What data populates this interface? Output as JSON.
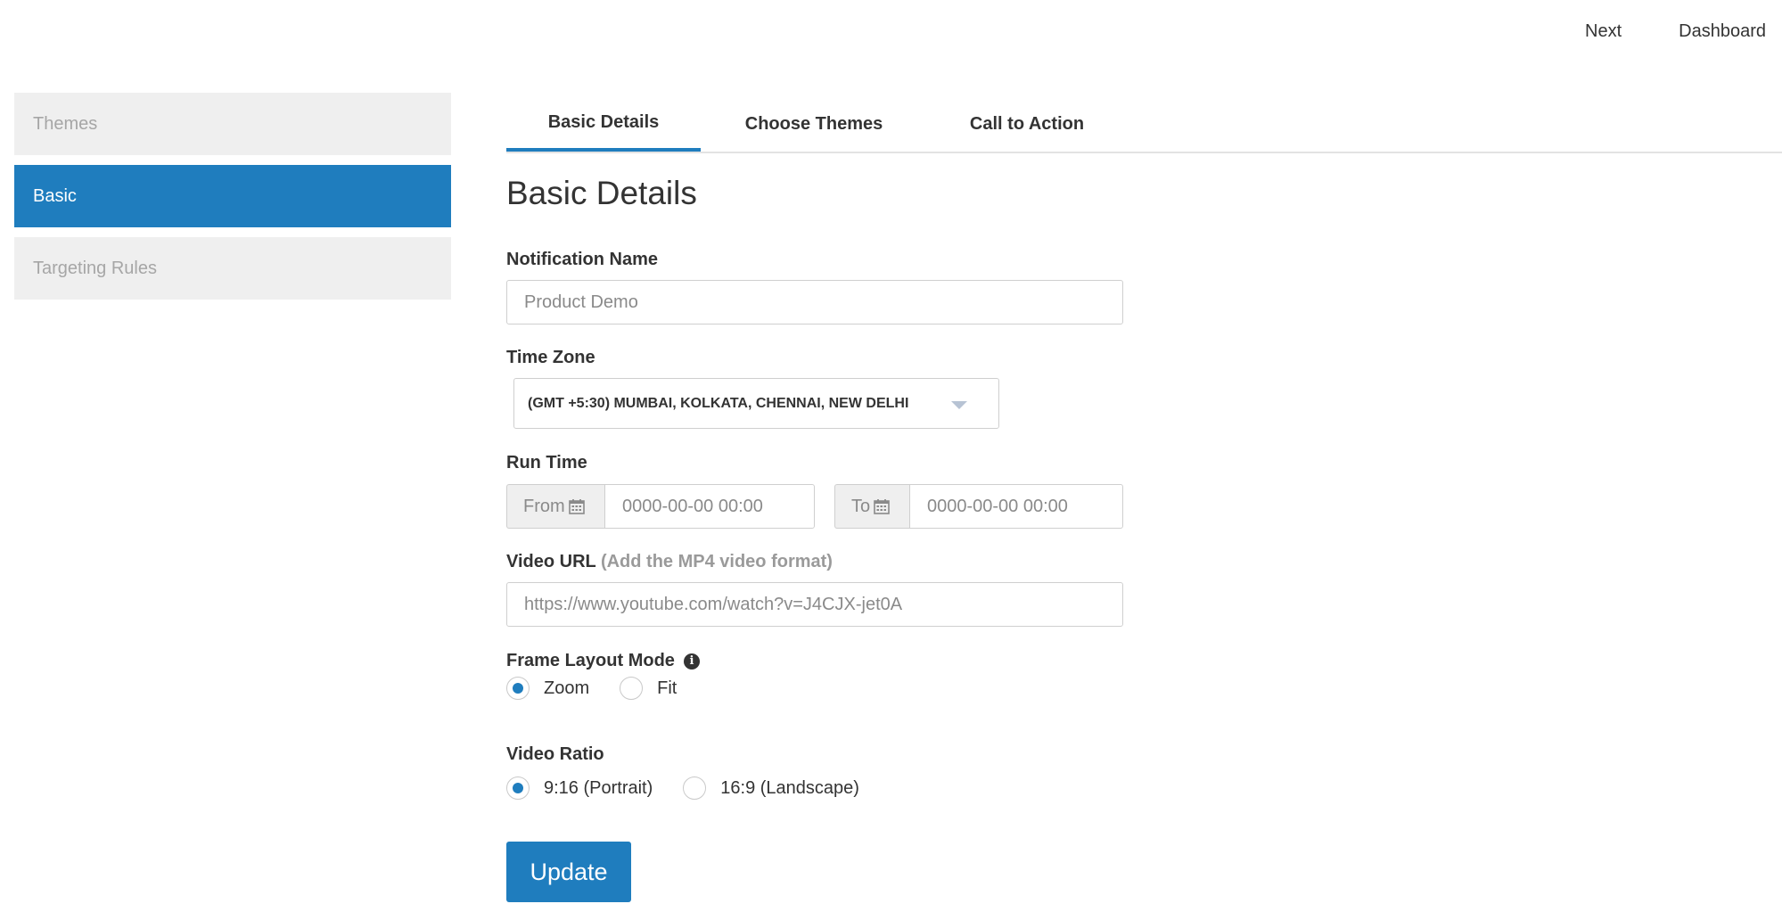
{
  "topnav": {
    "next": "Next",
    "dashboard": "Dashboard"
  },
  "sidebar": {
    "items": [
      {
        "label": "Themes",
        "active": false
      },
      {
        "label": "Basic",
        "active": true
      },
      {
        "label": "Targeting Rules",
        "active": false
      }
    ]
  },
  "tabs": [
    {
      "label": "Basic Details",
      "active": true
    },
    {
      "label": "Choose Themes",
      "active": false
    },
    {
      "label": "Call to Action",
      "active": false
    }
  ],
  "form": {
    "title": "Basic Details",
    "notification_name": {
      "label": "Notification Name",
      "placeholder": "Product Demo"
    },
    "time_zone": {
      "label": "Time Zone",
      "selected": "(GMT +5:30) MUMBAI, KOLKATA, CHENNAI, NEW DELHI"
    },
    "run_time": {
      "label": "Run Time",
      "from_label": "From",
      "from_placeholder": "0000-00-00 00:00",
      "to_label": "To",
      "to_placeholder": "0000-00-00 00:00"
    },
    "video_url": {
      "label": "Video URL",
      "hint": "(Add the MP4 video format)",
      "placeholder": "https://www.youtube.com/watch?v=J4CJX-jet0A"
    },
    "frame_layout": {
      "label": "Frame Layout Mode",
      "options": [
        {
          "label": "Zoom",
          "selected": true
        },
        {
          "label": "Fit",
          "selected": false
        }
      ]
    },
    "video_ratio": {
      "label": "Video Ratio",
      "options": [
        {
          "label": "9:16 (Portrait)",
          "selected": true
        },
        {
          "label": "16:9 (Landscape)",
          "selected": false
        }
      ]
    },
    "update_label": "Update"
  },
  "colors": {
    "accent": "#1f7dbe",
    "sidebar_inactive_bg": "#efefef",
    "sidebar_inactive_text": "#a6a6a6"
  }
}
